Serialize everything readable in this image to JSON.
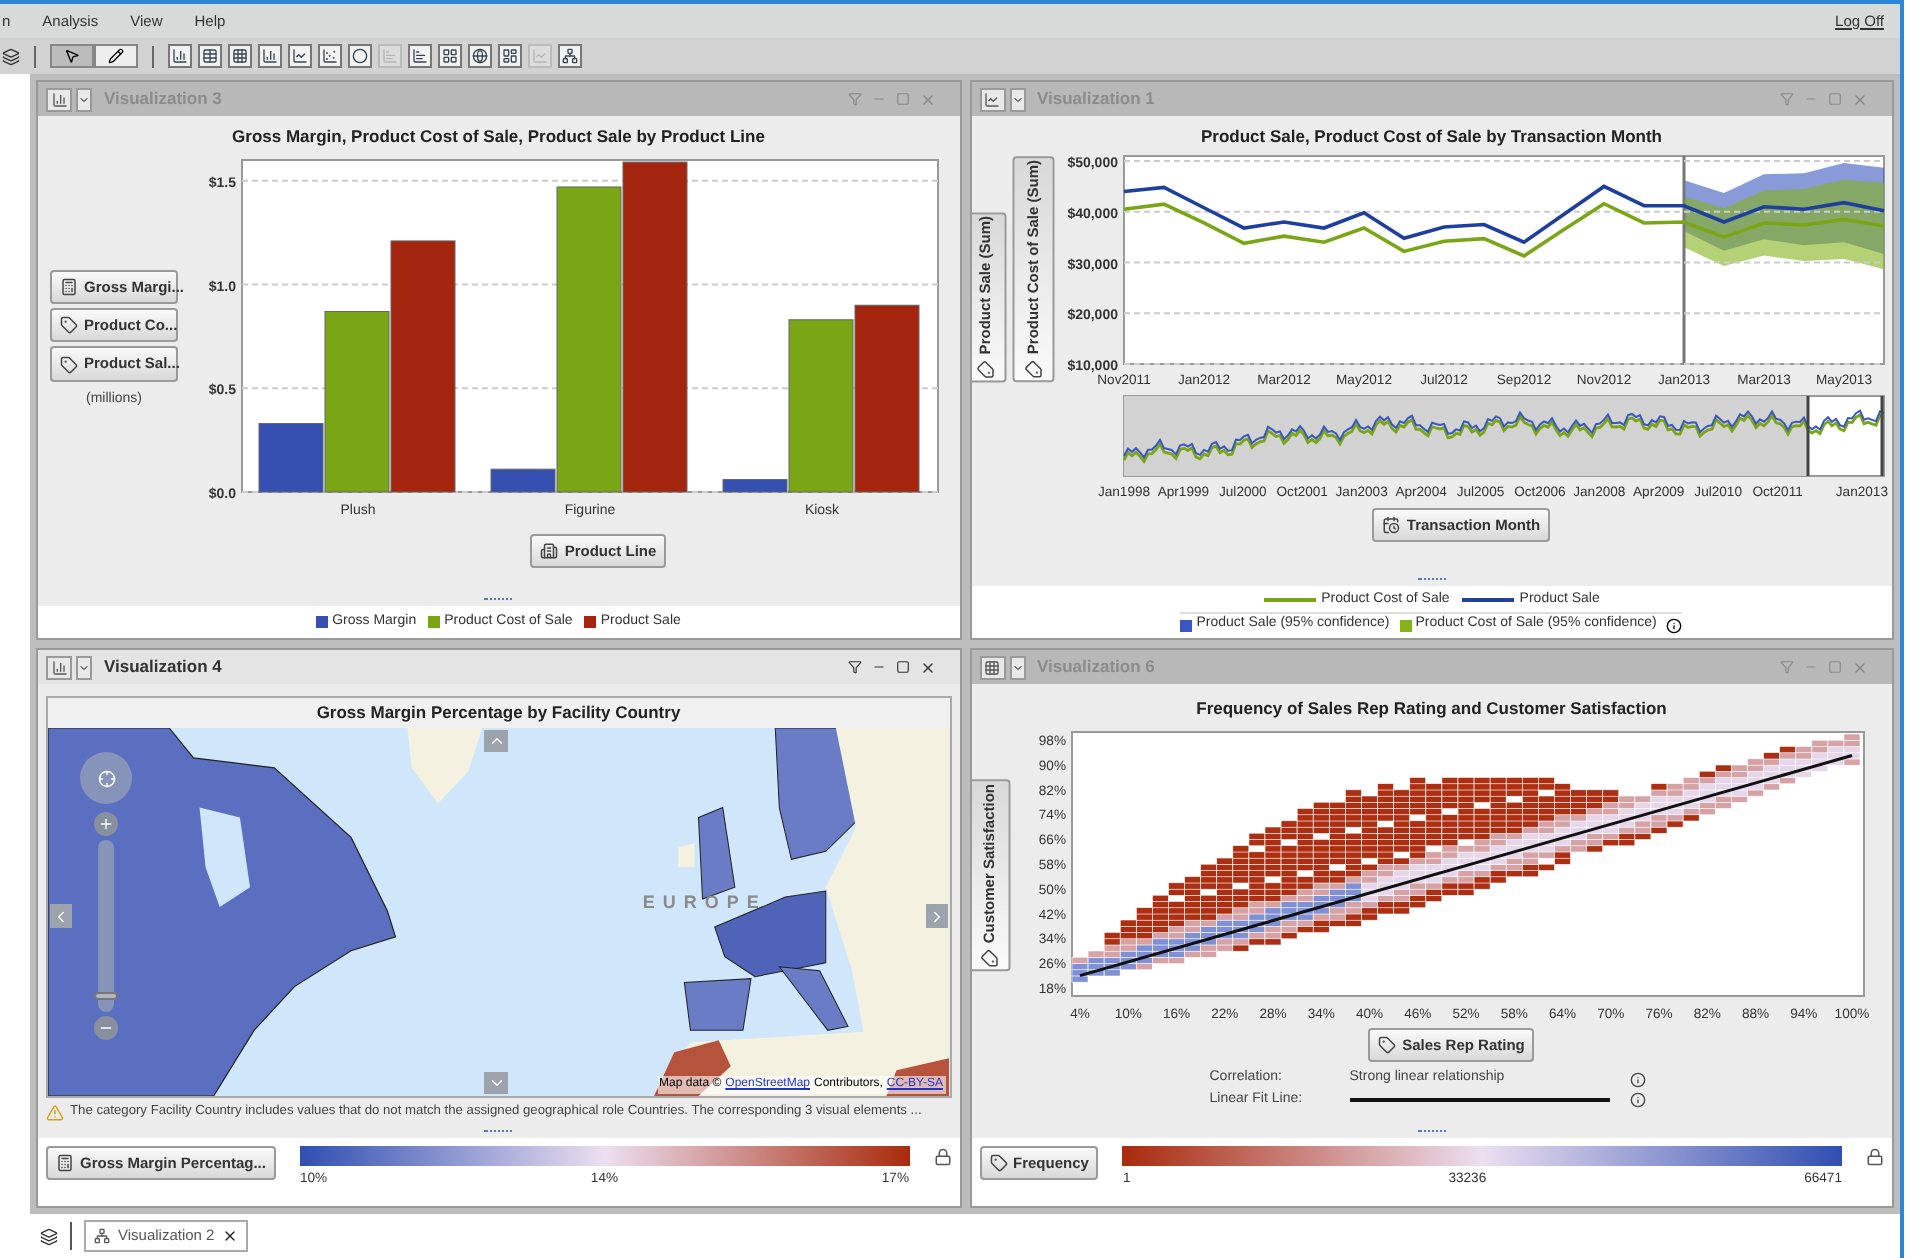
{
  "menu": {
    "items": [
      {
        "label": "n"
      },
      {
        "label": "Analysis"
      },
      {
        "label": "View"
      },
      {
        "label": "Help"
      }
    ],
    "log_off": "Log Off"
  },
  "toolbar": {
    "modes": [
      {
        "selected": true
      },
      {
        "selected": false
      }
    ],
    "tools": [
      {
        "disabled": false
      },
      {
        "disabled": false
      },
      {
        "disabled": false
      },
      {
        "disabled": false
      },
      {
        "disabled": false
      },
      {
        "disabled": false
      },
      {
        "disabled": false
      },
      {
        "disabled": true
      },
      {
        "disabled": false
      },
      {
        "disabled": false
      },
      {
        "disabled": false
      },
      {
        "disabled": false
      },
      {
        "disabled": true
      },
      {
        "disabled": false
      }
    ]
  },
  "panels": [
    {
      "kind": "bar",
      "title": "Visualization 3",
      "active": false,
      "measure_roles": [
        {
          "label": "Gross Margi...",
          "kind": "calculated"
        },
        {
          "label": "Product Co...",
          "kind": "measure"
        },
        {
          "label": "Product Sal...",
          "kind": "measure"
        }
      ],
      "unit_note": "(millions)",
      "category_role": {
        "label": "Product Line",
        "kind": "category"
      },
      "chart_data": {
        "type": "bar",
        "title": "Gross Margin, Product Cost of Sale, Product Sale by Product Line",
        "categories": [
          "Plush",
          "Figurine",
          "Kiosk"
        ],
        "series": [
          {
            "name": "Gross Margin",
            "color": "#3550b0",
            "values": [
              0.33,
              0.11,
              0.06
            ]
          },
          {
            "name": "Product Cost of Sale",
            "color": "#7aa616",
            "values": [
              0.87,
              1.47,
              0.83
            ]
          },
          {
            "name": "Product Sale",
            "color": "#a3250e",
            "values": [
              1.21,
              1.59,
              0.9
            ]
          }
        ],
        "ylim": [
          0,
          1.6
        ],
        "grid": true,
        "yticks": [
          {
            "value": 0,
            "label": "$0.0"
          },
          {
            "value": 0.5,
            "label": "$0.5"
          },
          {
            "value": 1,
            "label": "$1.0"
          },
          {
            "value": 1.5,
            "label": "$1.5"
          }
        ]
      }
    },
    {
      "kind": "line",
      "title": "Visualization 1",
      "active": false,
      "measure_roles": [
        {
          "label": "Product Sale (Sum)",
          "kind": "measure"
        },
        {
          "label": "Product Cost of Sale (Sum)",
          "kind": "measure"
        }
      ],
      "category_role": {
        "label": "Transaction Month",
        "kind": "date"
      },
      "overview_labels": [
        "Jan1998",
        "Apr1999",
        "Jul2000",
        "Oct2001",
        "Jan2003",
        "Apr2004",
        "Jul2005",
        "Oct2006",
        "Jan2008",
        "Apr2009",
        "Jul2010",
        "Oct2011",
        "Jan2013"
      ],
      "confidence_legend": [
        {
          "label": "Product Sale (95% confidence)",
          "color": "#3a56c0"
        },
        {
          "label": "Product Cost of Sale (95% confidence)",
          "color": "#84b21a"
        }
      ],
      "chart_data": {
        "type": "line",
        "title": "Product Sale, Product Cost of Sale by Transaction Month",
        "categories": [
          "Nov2011",
          null,
          "Jan2012",
          null,
          "Mar2012",
          null,
          "May2012",
          null,
          "Jul2012",
          null,
          "Sep2012",
          null,
          "Nov2012",
          null,
          "Jan2013",
          null,
          "Mar2013",
          null,
          "May2013",
          null
        ],
        "grid": true,
        "series": [
          {
            "name": "Product Cost of Sale",
            "color": "#7aa616",
            "values": [
              40500,
              41500,
              37800,
              33800,
              35200,
              34000,
              36800,
              32200,
              34200,
              34700,
              31300,
              36500,
              41600,
              37800,
              38000,
              35000,
              37800,
              37400,
              38500,
              37200
            ]
          },
          {
            "name": "Product Sale",
            "color": "#1f3f9e",
            "values": [
              44000,
              44800,
              40800,
              36800,
              38000,
              36800,
              39800,
              34800,
              37000,
              37500,
              34000,
              39500,
              45000,
              41200,
              41200,
              38000,
              41000,
              40500,
              41800,
              40200
            ]
          }
        ],
        "ylim": [
          10000,
          51000
        ],
        "yticks": [
          {
            "value": 10000,
            "label": "$10,000"
          },
          {
            "value": 20000,
            "label": "$20,000"
          },
          {
            "value": 30000,
            "label": "$30,000"
          },
          {
            "value": 40000,
            "label": "$40,000"
          },
          {
            "value": 50000,
            "label": "$50,000"
          }
        ]
      }
    },
    {
      "kind": "map",
      "title": "Visualization 4",
      "active": true,
      "map_title": "Gross Margin Percentage by Facility Country",
      "region_label": "EUROPE",
      "zoom": {
        "level": 0.07
      },
      "attribution": {
        "prefix": "Map data ©",
        "link": "OpenStreetMap",
        "middle": "Contributors,",
        "license": "CC-BY-SA"
      },
      "warning": "The category Facility Country includes values that do not match the assigned geographical role Countries. The corresponding 3 visual elements ...",
      "legend": {
        "role": {
          "label": "Gross Margin Percentag...",
          "kind": "calculated"
        },
        "ticks": [
          "10%",
          "14%",
          "17%"
        ]
      }
    },
    {
      "kind": "heatmap",
      "title": "Visualization 6",
      "active": false,
      "chart_title": "Frequency of Sales Rep Rating and Customer Satisfaction",
      "y_role": {
        "label": "Customer Satisfaction",
        "kind": "measure"
      },
      "x_role": {
        "label": "Sales Rep Rating",
        "kind": "measure"
      },
      "yticks": [
        "98%",
        "90%",
        "82%",
        "74%",
        "66%",
        "58%",
        "50%",
        "42%",
        "34%",
        "26%",
        "18%"
      ],
      "xticks": [
        "4%",
        "10%",
        "16%",
        "22%",
        "28%",
        "34%",
        "40%",
        "46%",
        "52%",
        "58%",
        "64%",
        "70%",
        "76%",
        "82%",
        "88%",
        "94%",
        "100%"
      ],
      "correlation": {
        "label": "Correlation:",
        "value": "Strong linear relationship"
      },
      "fit_line": {
        "label": "Linear Fit Line:"
      },
      "legend": {
        "role": {
          "label": "Frequency",
          "kind": "measure"
        },
        "ticks": [
          "1",
          "33236",
          "66471"
        ]
      }
    }
  ],
  "bottom_tabs": [
    {
      "label": "Visualization 2",
      "selected": true
    }
  ]
}
